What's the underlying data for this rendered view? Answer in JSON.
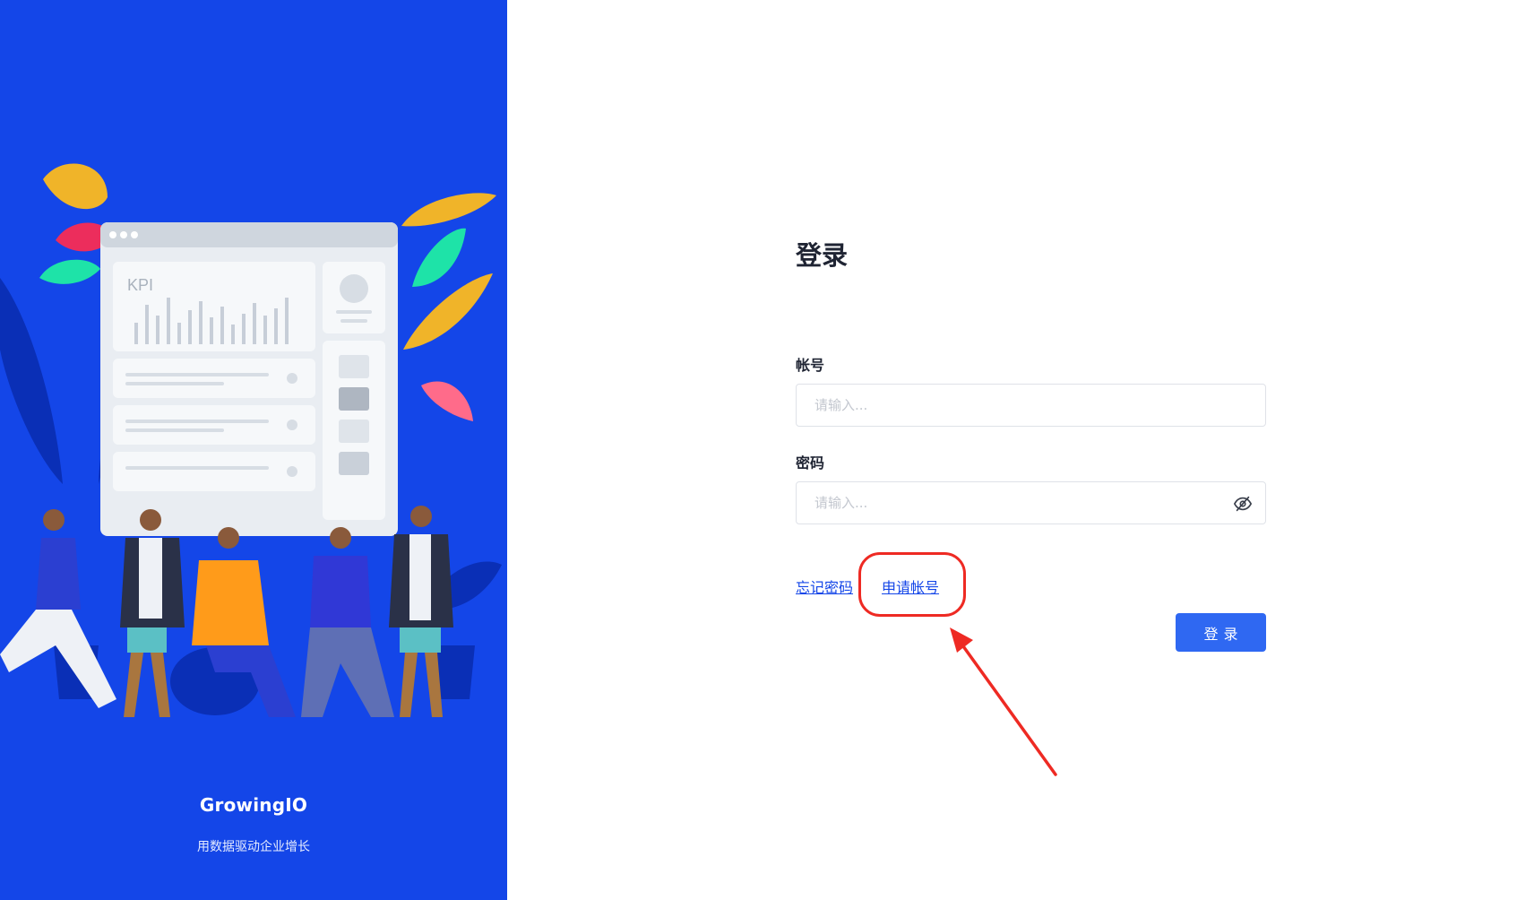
{
  "brand": {
    "name": "GrowingIO",
    "tagline": "用数据驱动企业增长",
    "illustration_card_label": "KPI",
    "background_color": "#1446e8"
  },
  "login": {
    "title": "登录",
    "account": {
      "label": "帐号",
      "placeholder": "请输入..."
    },
    "password": {
      "label": "密码",
      "placeholder": "请输入...",
      "toggle_icon": "eye-off-icon"
    },
    "links": {
      "forgot_password": "忘记密码",
      "apply_account": "申请帐号"
    },
    "submit_label": "登录",
    "accent_color": "#2f68f2"
  },
  "annotation": {
    "color": "#ee2a23"
  }
}
